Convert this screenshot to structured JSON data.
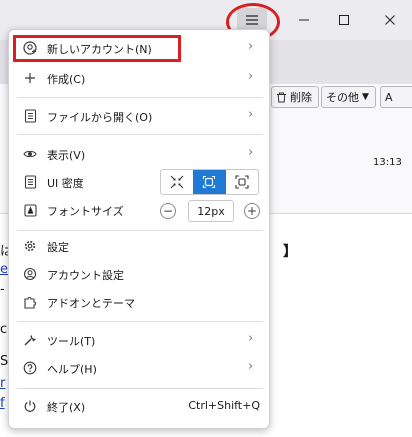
{
  "window": {
    "menu_icon": "hamburger-icon",
    "minimize_icon": "minimize-icon",
    "maximize_icon": "maximize-icon",
    "close_icon": "close-icon"
  },
  "background": {
    "delete_label": "削除",
    "more_label": "その他",
    "time": "13:13",
    "bracket": "】",
    "fragments": [
      "は",
      "e",
      "-",
      "c",
      "S",
      "r",
      "f"
    ]
  },
  "menu": {
    "items": [
      {
        "label": "新しいアカウント(N)",
        "icon": "new-account-icon"
      },
      {
        "label": "作成(C)",
        "icon": "plus-icon"
      },
      {
        "label": "ファイルから開く(O)",
        "icon": "open-file-icon"
      },
      {
        "label": "表示(V)",
        "icon": "eye-icon"
      },
      {
        "label": "UI 密度",
        "icon": "density-icon"
      },
      {
        "label": "フォントサイズ",
        "icon": "font-size-icon"
      },
      {
        "label": "設定",
        "icon": "gear-icon"
      },
      {
        "label": "アカウント設定",
        "icon": "account-settings-icon"
      },
      {
        "label": "アドオンとテーマ",
        "icon": "puzzle-icon"
      },
      {
        "label": "ツール(T)",
        "icon": "wrench-icon"
      },
      {
        "label": "ヘルプ(H)",
        "icon": "help-icon"
      },
      {
        "label": "終了(X)",
        "icon": "power-icon",
        "shortcut": "Ctrl+Shift+Q"
      }
    ],
    "density_selected": "normal",
    "font_size": "12px",
    "minus": "−",
    "plus": "+"
  },
  "colors": {
    "accent": "#1f7ad6",
    "highlight": "#d92020"
  }
}
